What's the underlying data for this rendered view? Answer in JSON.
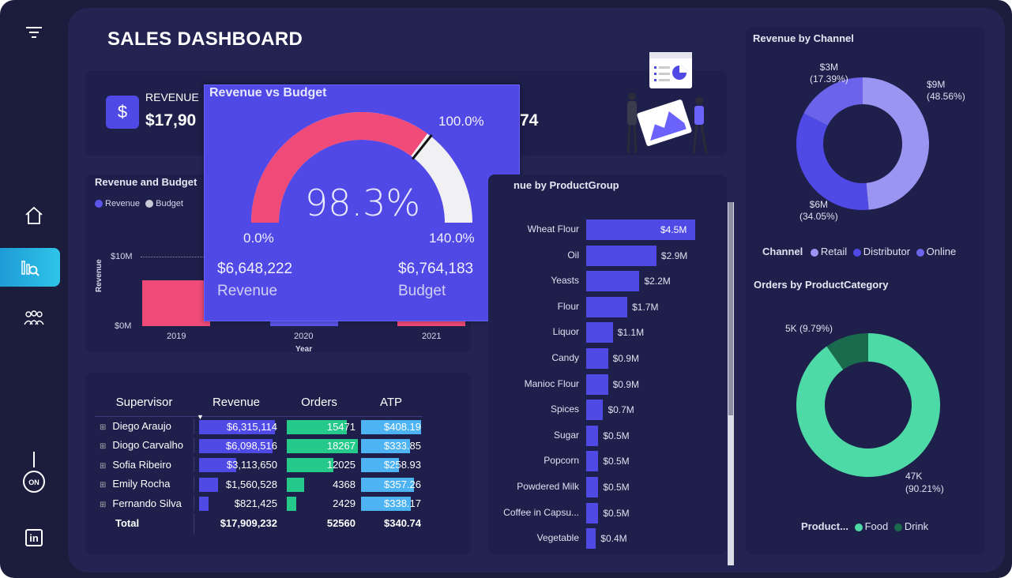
{
  "title": "SALES DASHBOARD",
  "sidebar": {
    "items": [
      {
        "name": "filter-icon"
      },
      {
        "name": "home-icon"
      },
      {
        "name": "analytics-icon",
        "active": true
      },
      {
        "name": "team-icon"
      },
      {
        "name": "power-toggle-icon",
        "label": "ON"
      },
      {
        "name": "linkedin-icon",
        "label": "in"
      }
    ]
  },
  "kpi": {
    "revenue_label": "REVENUE",
    "revenue_value": "$17,90",
    "hidden_value_tail": "74",
    "icon": "$"
  },
  "popup": {
    "title": "Revenue vs Budget",
    "gauge_value": "98.3%",
    "gauge_fill_fraction": 0.702,
    "min_label": "0.0%",
    "max_label": "140.0%",
    "target_label": "100.0%",
    "revenue_amount": "$6,648,222",
    "revenue_label": "Revenue",
    "budget_amount": "$6,764,183",
    "budget_label": "Budget"
  },
  "revenue_budget_chart": {
    "title": "Revenue and Budget",
    "legend": [
      "Revenue",
      "Budget"
    ],
    "ylabel": "Revenue",
    "xlabel": "Year",
    "y_ticks": [
      "$10M",
      "$0M"
    ],
    "x_ticks": [
      "2019",
      "2020",
      "2021"
    ]
  },
  "supervisor_table": {
    "headers": [
      "Supervisor",
      "Revenue",
      "Orders",
      "ATP"
    ],
    "rows": [
      {
        "name": "Diego Araujo",
        "revenue": "$6,315,114",
        "orders": "15471",
        "atp": "$408.19",
        "rev_frac": 1.0,
        "ord_frac": 0.847,
        "atp_frac": 1.0
      },
      {
        "name": "Diogo Carvalho",
        "revenue": "$6,098,516",
        "orders": "18267",
        "atp": "$333.85",
        "rev_frac": 0.966,
        "ord_frac": 1.0,
        "atp_frac": 0.818
      },
      {
        "name": "Sofia Ribeiro",
        "revenue": "$3,113,650",
        "orders": "12025",
        "atp": "$258.93",
        "rev_frac": 0.493,
        "ord_frac": 0.658,
        "atp_frac": 0.634
      },
      {
        "name": "Emily Rocha",
        "revenue": "$1,560,528",
        "orders": "4368",
        "atp": "$357.26",
        "rev_frac": 0.247,
        "ord_frac": 0.239,
        "atp_frac": 0.875
      },
      {
        "name": "Fernando Silva",
        "revenue": "$821,425",
        "orders": "2429",
        "atp": "$338.17",
        "rev_frac": 0.13,
        "ord_frac": 0.133,
        "atp_frac": 0.828
      }
    ],
    "total": {
      "label": "Total",
      "revenue": "$17,909,232",
      "orders": "52560",
      "atp": "$340.74"
    }
  },
  "product_group": {
    "title": "nue by ProductGroup",
    "items": [
      {
        "name": "Wheat Flour",
        "value": 4.5,
        "label": "$4.5M"
      },
      {
        "name": "Oil",
        "value": 2.9,
        "label": "$2.9M"
      },
      {
        "name": "Yeasts",
        "value": 2.2,
        "label": "$2.2M"
      },
      {
        "name": "Flour",
        "value": 1.7,
        "label": "$1.7M"
      },
      {
        "name": "Liquor",
        "value": 1.1,
        "label": "$1.1M"
      },
      {
        "name": "Candy",
        "value": 0.9,
        "label": "$0.9M"
      },
      {
        "name": "Manioc Flour",
        "value": 0.9,
        "label": "$0.9M"
      },
      {
        "name": "Spices",
        "value": 0.7,
        "label": "$0.7M"
      },
      {
        "name": "Sugar",
        "value": 0.5,
        "label": "$0.5M"
      },
      {
        "name": "Popcorn",
        "value": 0.5,
        "label": "$0.5M"
      },
      {
        "name": "Powdered Milk",
        "value": 0.5,
        "label": "$0.5M"
      },
      {
        "name": "Coffee in Capsu...",
        "value": 0.5,
        "label": "$0.5M"
      },
      {
        "name": "Vegetable",
        "value": 0.4,
        "label": "$0.4M"
      }
    ]
  },
  "channel": {
    "title": "Revenue by Channel",
    "legend_title": "Channel",
    "legend": [
      "Retail",
      "Distributor",
      "Online"
    ],
    "slices": [
      {
        "name": "Retail",
        "value": 48.56,
        "amount": "$9M",
        "pct": "(48.56%)",
        "color": "#9b95f2"
      },
      {
        "name": "Distributor",
        "value": 34.05,
        "amount": "$6M",
        "pct": "(34.05%)",
        "color": "#4f4ae6"
      },
      {
        "name": "Online",
        "value": 17.39,
        "amount": "$3M",
        "pct": "(17.39%)",
        "color": "#6b64ea"
      }
    ]
  },
  "category": {
    "title": "Orders by ProductCategory",
    "legend_title": "Product...",
    "legend": [
      "Food",
      "Drink"
    ],
    "slices": [
      {
        "name": "Food",
        "value": 90.21,
        "label": "47K",
        "pct": "(90.21%)",
        "color": "#4ddaa6"
      },
      {
        "name": "Drink",
        "value": 9.79,
        "label": "5K (9.79%)",
        "color": "#1a6b4d"
      }
    ]
  }
}
